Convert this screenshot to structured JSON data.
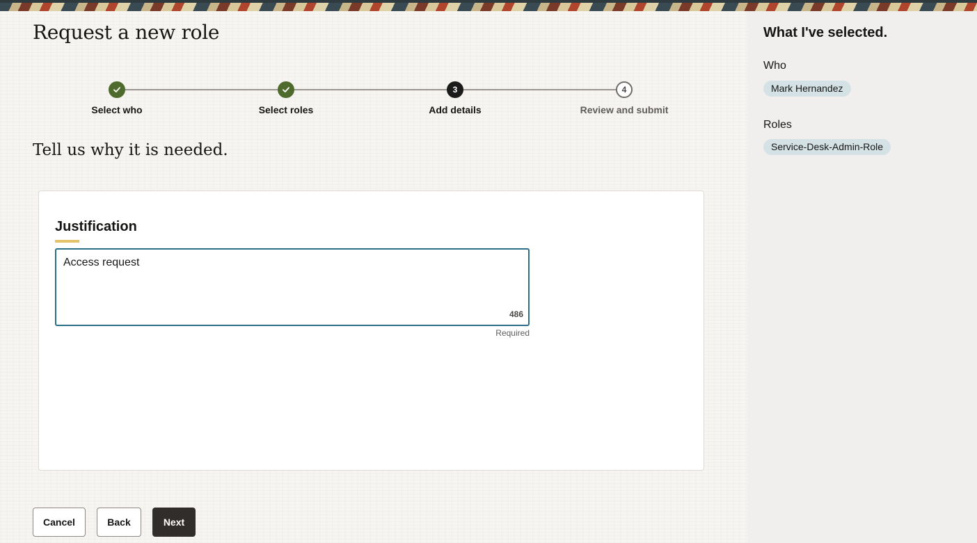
{
  "page": {
    "title": "Request a new role"
  },
  "stepper": {
    "steps": [
      {
        "label": "Select who",
        "status": "complete",
        "marker": "check-icon"
      },
      {
        "label": "Select roles",
        "status": "complete",
        "marker": "check-icon"
      },
      {
        "label": "Add details",
        "status": "current",
        "number": "3"
      },
      {
        "label": "Review and submit",
        "status": "upcoming",
        "number": "4"
      }
    ]
  },
  "section": {
    "heading": "Tell us why it is needed."
  },
  "justification": {
    "title": "Justification",
    "value": "Access request",
    "remaining_chars": "486",
    "required_text": "Required"
  },
  "actions": {
    "cancel_label": "Cancel",
    "back_label": "Back",
    "next_label": "Next"
  },
  "summary": {
    "title": "What I've selected.",
    "who_label": "Who",
    "who_value": "Mark Hernandez",
    "roles_label": "Roles",
    "roles": [
      "Service-Desk-Admin-Role"
    ]
  },
  "colors": {
    "step_complete": "#4f6a2d",
    "step_current": "#1b1b1b",
    "textarea_focus_border": "#2b6f87",
    "title_accent": "#e5c36b",
    "chip_background": "#d4e1e5",
    "primary_button": "#312d2a"
  }
}
